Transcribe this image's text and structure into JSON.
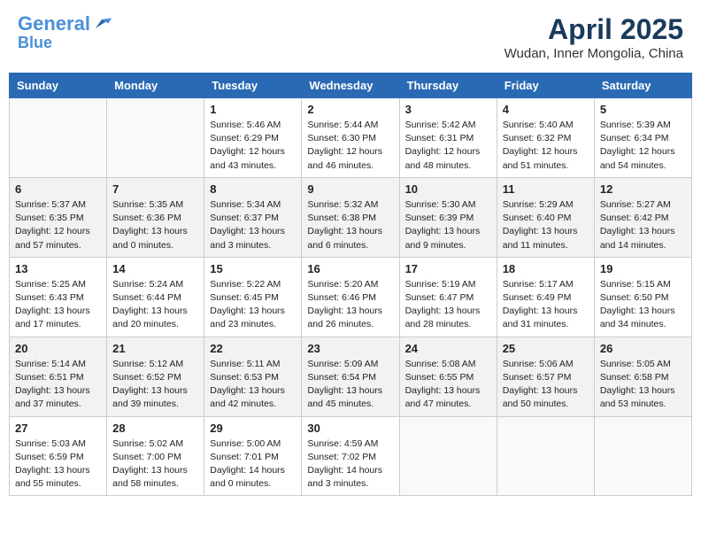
{
  "header": {
    "logo_line1": "General",
    "logo_line2": "Blue",
    "month": "April 2025",
    "location": "Wudan, Inner Mongolia, China"
  },
  "weekdays": [
    "Sunday",
    "Monday",
    "Tuesday",
    "Wednesday",
    "Thursday",
    "Friday",
    "Saturday"
  ],
  "weeks": [
    [
      {
        "day": "",
        "info": ""
      },
      {
        "day": "",
        "info": ""
      },
      {
        "day": "1",
        "info": "Sunrise: 5:46 AM\nSunset: 6:29 PM\nDaylight: 12 hours\nand 43 minutes."
      },
      {
        "day": "2",
        "info": "Sunrise: 5:44 AM\nSunset: 6:30 PM\nDaylight: 12 hours\nand 46 minutes."
      },
      {
        "day": "3",
        "info": "Sunrise: 5:42 AM\nSunset: 6:31 PM\nDaylight: 12 hours\nand 48 minutes."
      },
      {
        "day": "4",
        "info": "Sunrise: 5:40 AM\nSunset: 6:32 PM\nDaylight: 12 hours\nand 51 minutes."
      },
      {
        "day": "5",
        "info": "Sunrise: 5:39 AM\nSunset: 6:34 PM\nDaylight: 12 hours\nand 54 minutes."
      }
    ],
    [
      {
        "day": "6",
        "info": "Sunrise: 5:37 AM\nSunset: 6:35 PM\nDaylight: 12 hours\nand 57 minutes."
      },
      {
        "day": "7",
        "info": "Sunrise: 5:35 AM\nSunset: 6:36 PM\nDaylight: 13 hours\nand 0 minutes."
      },
      {
        "day": "8",
        "info": "Sunrise: 5:34 AM\nSunset: 6:37 PM\nDaylight: 13 hours\nand 3 minutes."
      },
      {
        "day": "9",
        "info": "Sunrise: 5:32 AM\nSunset: 6:38 PM\nDaylight: 13 hours\nand 6 minutes."
      },
      {
        "day": "10",
        "info": "Sunrise: 5:30 AM\nSunset: 6:39 PM\nDaylight: 13 hours\nand 9 minutes."
      },
      {
        "day": "11",
        "info": "Sunrise: 5:29 AM\nSunset: 6:40 PM\nDaylight: 13 hours\nand 11 minutes."
      },
      {
        "day": "12",
        "info": "Sunrise: 5:27 AM\nSunset: 6:42 PM\nDaylight: 13 hours\nand 14 minutes."
      }
    ],
    [
      {
        "day": "13",
        "info": "Sunrise: 5:25 AM\nSunset: 6:43 PM\nDaylight: 13 hours\nand 17 minutes."
      },
      {
        "day": "14",
        "info": "Sunrise: 5:24 AM\nSunset: 6:44 PM\nDaylight: 13 hours\nand 20 minutes."
      },
      {
        "day": "15",
        "info": "Sunrise: 5:22 AM\nSunset: 6:45 PM\nDaylight: 13 hours\nand 23 minutes."
      },
      {
        "day": "16",
        "info": "Sunrise: 5:20 AM\nSunset: 6:46 PM\nDaylight: 13 hours\nand 26 minutes."
      },
      {
        "day": "17",
        "info": "Sunrise: 5:19 AM\nSunset: 6:47 PM\nDaylight: 13 hours\nand 28 minutes."
      },
      {
        "day": "18",
        "info": "Sunrise: 5:17 AM\nSunset: 6:49 PM\nDaylight: 13 hours\nand 31 minutes."
      },
      {
        "day": "19",
        "info": "Sunrise: 5:15 AM\nSunset: 6:50 PM\nDaylight: 13 hours\nand 34 minutes."
      }
    ],
    [
      {
        "day": "20",
        "info": "Sunrise: 5:14 AM\nSunset: 6:51 PM\nDaylight: 13 hours\nand 37 minutes."
      },
      {
        "day": "21",
        "info": "Sunrise: 5:12 AM\nSunset: 6:52 PM\nDaylight: 13 hours\nand 39 minutes."
      },
      {
        "day": "22",
        "info": "Sunrise: 5:11 AM\nSunset: 6:53 PM\nDaylight: 13 hours\nand 42 minutes."
      },
      {
        "day": "23",
        "info": "Sunrise: 5:09 AM\nSunset: 6:54 PM\nDaylight: 13 hours\nand 45 minutes."
      },
      {
        "day": "24",
        "info": "Sunrise: 5:08 AM\nSunset: 6:55 PM\nDaylight: 13 hours\nand 47 minutes."
      },
      {
        "day": "25",
        "info": "Sunrise: 5:06 AM\nSunset: 6:57 PM\nDaylight: 13 hours\nand 50 minutes."
      },
      {
        "day": "26",
        "info": "Sunrise: 5:05 AM\nSunset: 6:58 PM\nDaylight: 13 hours\nand 53 minutes."
      }
    ],
    [
      {
        "day": "27",
        "info": "Sunrise: 5:03 AM\nSunset: 6:59 PM\nDaylight: 13 hours\nand 55 minutes."
      },
      {
        "day": "28",
        "info": "Sunrise: 5:02 AM\nSunset: 7:00 PM\nDaylight: 13 hours\nand 58 minutes."
      },
      {
        "day": "29",
        "info": "Sunrise: 5:00 AM\nSunset: 7:01 PM\nDaylight: 14 hours\nand 0 minutes."
      },
      {
        "day": "30",
        "info": "Sunrise: 4:59 AM\nSunset: 7:02 PM\nDaylight: 14 hours\nand 3 minutes."
      },
      {
        "day": "",
        "info": ""
      },
      {
        "day": "",
        "info": ""
      },
      {
        "day": "",
        "info": ""
      }
    ]
  ]
}
